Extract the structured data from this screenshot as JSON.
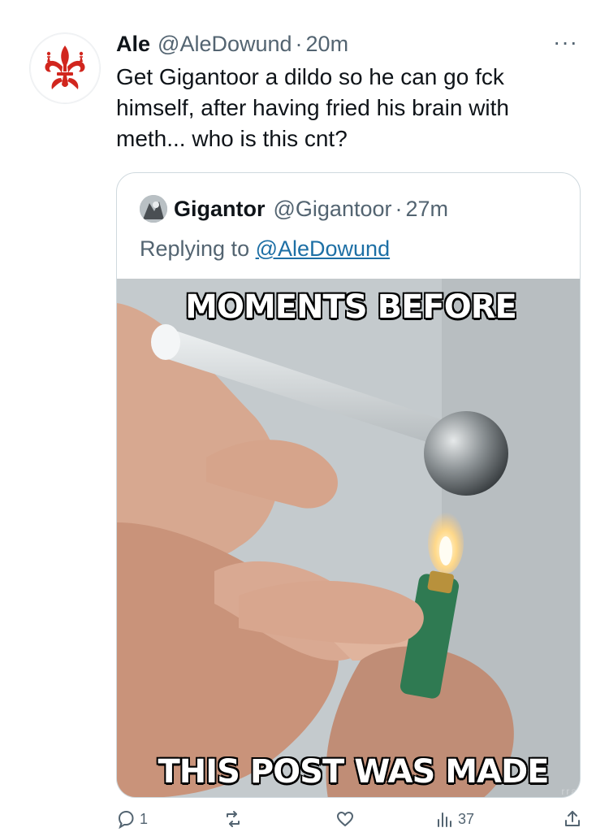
{
  "tweet": {
    "display_name": "Ale",
    "handle": "@AleDowund",
    "separator": "·",
    "time": "20m",
    "more": "···",
    "text": "Get Gigantoor a dildo so he can go fck\nhimself, after having fried his brain with\nmeth... who is this cnt?"
  },
  "quote": {
    "display_name": "Gigantor",
    "handle": "@Gigantoor",
    "separator": "·",
    "time": "27m",
    "replying_prefix": "Replying to ",
    "replying_handle": "@AleDowund",
    "meme_top": "MOMENTS BEFORE",
    "meme_bottom": "THIS POST WAS MADE",
    "watermark": "rra"
  },
  "actions": {
    "reply_count": "1",
    "retweet_count": "",
    "like_count": "",
    "views_count": "37"
  },
  "colors": {
    "text": "#0f1419",
    "secondary": "#536471",
    "link": "#1d6fa5",
    "border": "#cfd9de",
    "avatar_red": "#d1261e"
  }
}
